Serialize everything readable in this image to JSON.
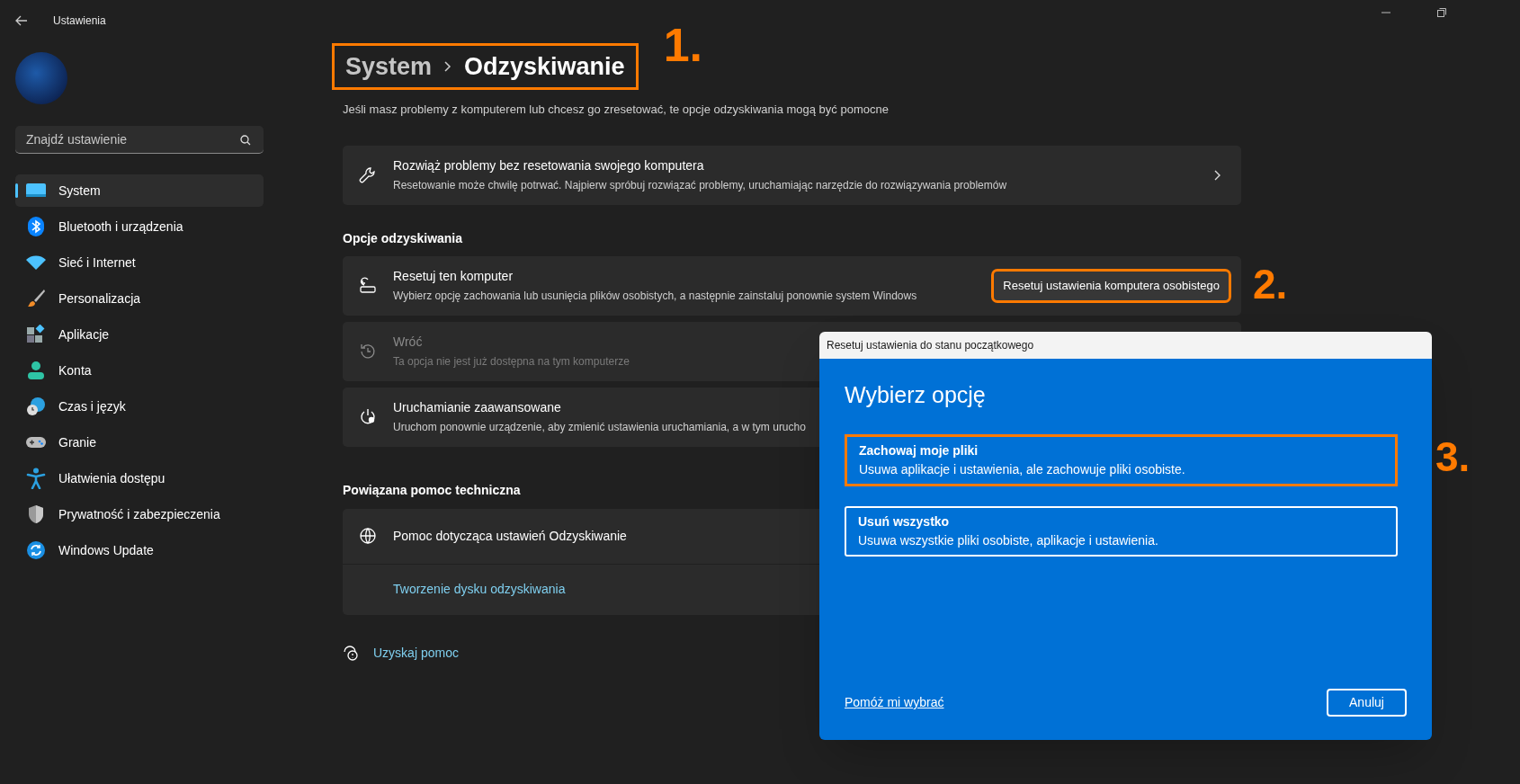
{
  "window": {
    "title": "Ustawienia"
  },
  "sidebar": {
    "search": {
      "placeholder": "Znajdź ustawienie"
    },
    "items": [
      {
        "label": "System",
        "selected": true
      },
      {
        "label": "Bluetooth i urządzenia",
        "selected": false
      },
      {
        "label": "Sieć i Internet",
        "selected": false
      },
      {
        "label": "Personalizacja",
        "selected": false
      },
      {
        "label": "Aplikacje",
        "selected": false
      },
      {
        "label": "Konta",
        "selected": false
      },
      {
        "label": "Czas i język",
        "selected": false
      },
      {
        "label": "Granie",
        "selected": false
      },
      {
        "label": "Ułatwienia dostępu",
        "selected": false
      },
      {
        "label": "Prywatność i zabezpieczenia",
        "selected": false
      },
      {
        "label": "Windows Update",
        "selected": false
      }
    ]
  },
  "breadcrumb": {
    "parent": "System",
    "current": "Odzyskiwanie",
    "highlighted": true,
    "annotation": "1."
  },
  "description": "Jeśli masz problemy z komputerem lub chcesz go zresetować, te opcje odzyskiwania mogą być pomocne",
  "troubleshoot_card": {
    "title": "Rozwiąż problemy bez resetowania swojego komputera",
    "subtitle": "Resetowanie może chwilę potrwać. Najpierw spróbuj rozwiązać problemy, uruchamiając narzędzie do rozwiązywania problemów"
  },
  "recovery_options": {
    "heading": "Opcje odzyskiwania",
    "items": [
      {
        "kind": "button",
        "title": "Resetuj ten komputer",
        "subtitle": "Wybierz opcję zachowania lub usunięcia plików osobistych, a następnie zainstaluj ponownie system Windows",
        "disabled": false,
        "button": {
          "label": "Resetuj ustawienia komputera osobistego",
          "highlighted": true,
          "annotation": "2."
        }
      },
      {
        "kind": "plain",
        "title": "Wróć",
        "subtitle": "Ta opcja nie jest już dostępna na tym komputerze",
        "disabled": true
      },
      {
        "kind": "plain",
        "title": "Uruchamianie zaawansowane",
        "subtitle": "Uruchom ponownie urządzenie, aby zmienić ustawienia uruchamiania, a w tym urucho",
        "disabled": false
      }
    ]
  },
  "related_help": {
    "heading": "Powiązana pomoc techniczna",
    "title": "Pomoc dotycząca ustawień Odzyskiwanie",
    "links": [
      "Tworzenie dysku odzyskiwania"
    ]
  },
  "get_help": "Uzyskaj pomoc",
  "dialog": {
    "title": "Resetuj ustawienia do stanu początkowego",
    "heading": "Wybierz opcję",
    "options": [
      {
        "title": "Zachowaj moje pliki",
        "description": "Usuwa aplikacje i ustawienia, ale zachowuje pliki osobiste.",
        "highlighted": true,
        "annotation": "3."
      },
      {
        "title": "Usuń wszystko",
        "description": "Usuwa wszystkie pliki osobiste, aplikacje i ustawienia.",
        "highlighted": false
      }
    ],
    "help_link": "Pomóż mi wybrać",
    "cancel": "Anuluj"
  }
}
